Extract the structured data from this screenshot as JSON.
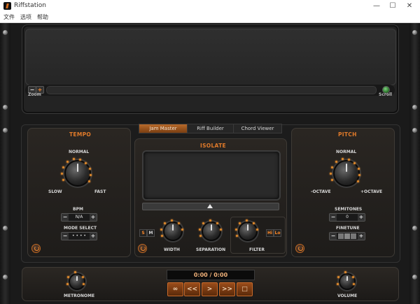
{
  "window": {
    "title": "Riffstation",
    "minimize": "—",
    "maximize": "☐",
    "close": "✕"
  },
  "menu": {
    "items": [
      "文件",
      "选项",
      "帮助"
    ]
  },
  "top_panel": {
    "zoom_minus": "−",
    "zoom_plus": "+",
    "zoom_label": "Zoom",
    "scroll_label": "Scroll"
  },
  "tempo": {
    "title": "TEMPO",
    "normal": "NORMAL",
    "slow": "SLOW",
    "fast": "FAST",
    "bpm_label": "BPM",
    "bpm_value": "N/A",
    "mode_label": "MODE SELECT",
    "mode_value": "• • • •",
    "minus": "−",
    "plus": "+"
  },
  "tabs": [
    {
      "label": "Jam Master",
      "active": true
    },
    {
      "label": "Riff Builder",
      "active": false
    },
    {
      "label": "Chord Viewer",
      "active": false
    }
  ],
  "isolate": {
    "title": "ISOLATE",
    "slider_position": 0.5,
    "s_label": "S",
    "m_label": "M",
    "width_label": "WIDTH",
    "separation_label": "SEPARATION",
    "filter_label": "FILTER",
    "hi_label": "Hi",
    "lo_label": "Lo"
  },
  "pitch": {
    "title": "PITCH",
    "normal": "NORMAL",
    "minus_octave": "-OCTAVE",
    "plus_octave": "+OCTAVE",
    "semitones_label": "SEMITONES",
    "semitones_value": "0",
    "finetune_label": "FINETUNE",
    "minus": "−",
    "plus": "+"
  },
  "transport": {
    "time": "0:00 / 0:00",
    "loop": "∞",
    "rewind": "<<",
    "play": ">",
    "forward": ">>",
    "stop": "□"
  },
  "bottom": {
    "metronome_label": "METRONOME",
    "volume_label": "VOLUME"
  },
  "colors": {
    "accent": "#e07a2a",
    "led": "#e08a2a",
    "scroll_led": "#4caf50"
  }
}
